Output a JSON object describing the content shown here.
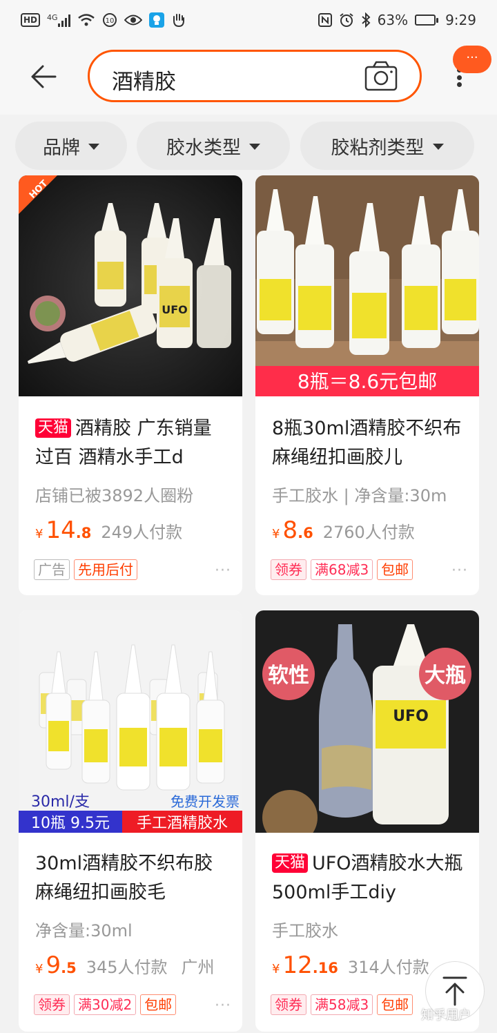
{
  "status_bar": {
    "hd": "HD",
    "network": "4G",
    "battery": "63%",
    "time": "9:29",
    "battery_level": 0.63
  },
  "search": {
    "query": "酒精胶",
    "back_icon": "back-arrow-icon",
    "camera_icon": "camera-icon",
    "more_icon": "more-vertical-icon",
    "msg_badge": "···"
  },
  "filters": [
    "品牌",
    "胶水类型",
    "胶粘剂类型"
  ],
  "products": [
    {
      "badge": "HOT",
      "tmall": "天猫",
      "title": "酒精胶 广东销量过百 酒精水手工d",
      "sub": "店铺已被3892人圈粉",
      "yen": "¥",
      "price_int": "14",
      "price_dec": ".8",
      "sales": "249人付款",
      "location": "",
      "tags": [
        "广告",
        "先用后付"
      ]
    },
    {
      "banner": "8瓶＝8.6元包邮",
      "tmall": "",
      "title": "8瓶30ml酒精胶不织布麻绳纽扣画胶儿",
      "sub": "手工胶水 | 净含量:30m",
      "yen": "¥",
      "price_int": "8",
      "price_dec": ".6",
      "sales": "2760人付款",
      "location": "",
      "tags": [
        "领券",
        "满68减3",
        "包邮"
      ]
    },
    {
      "img_label_1": "30ml/支",
      "img_label_2": "免费开发票",
      "img_label_3": "10瓶 9.5元",
      "img_label_4": "手工酒精胶水",
      "tmall": "",
      "title": "30ml酒精胶不织布胶麻绳纽扣画胶毛",
      "sub": "净含量:30ml",
      "yen": "¥",
      "price_int": "9",
      "price_dec": ".5",
      "sales": "345人付款",
      "location": "广州",
      "tags": [
        "领券",
        "满30减2",
        "包邮"
      ]
    },
    {
      "img_label_1": "软性",
      "img_label_2": "大瓶",
      "tmall": "天猫",
      "title": "UFO酒精胶水大瓶500ml手工diy",
      "sub": "手工胶水",
      "yen": "¥",
      "price_int": "12",
      "price_dec": ".16",
      "sales": "314人付款",
      "location": "",
      "tags": [
        "领券",
        "满58减3",
        "包邮"
      ]
    }
  ],
  "more_dots": "···",
  "watermark": "知乎用户"
}
